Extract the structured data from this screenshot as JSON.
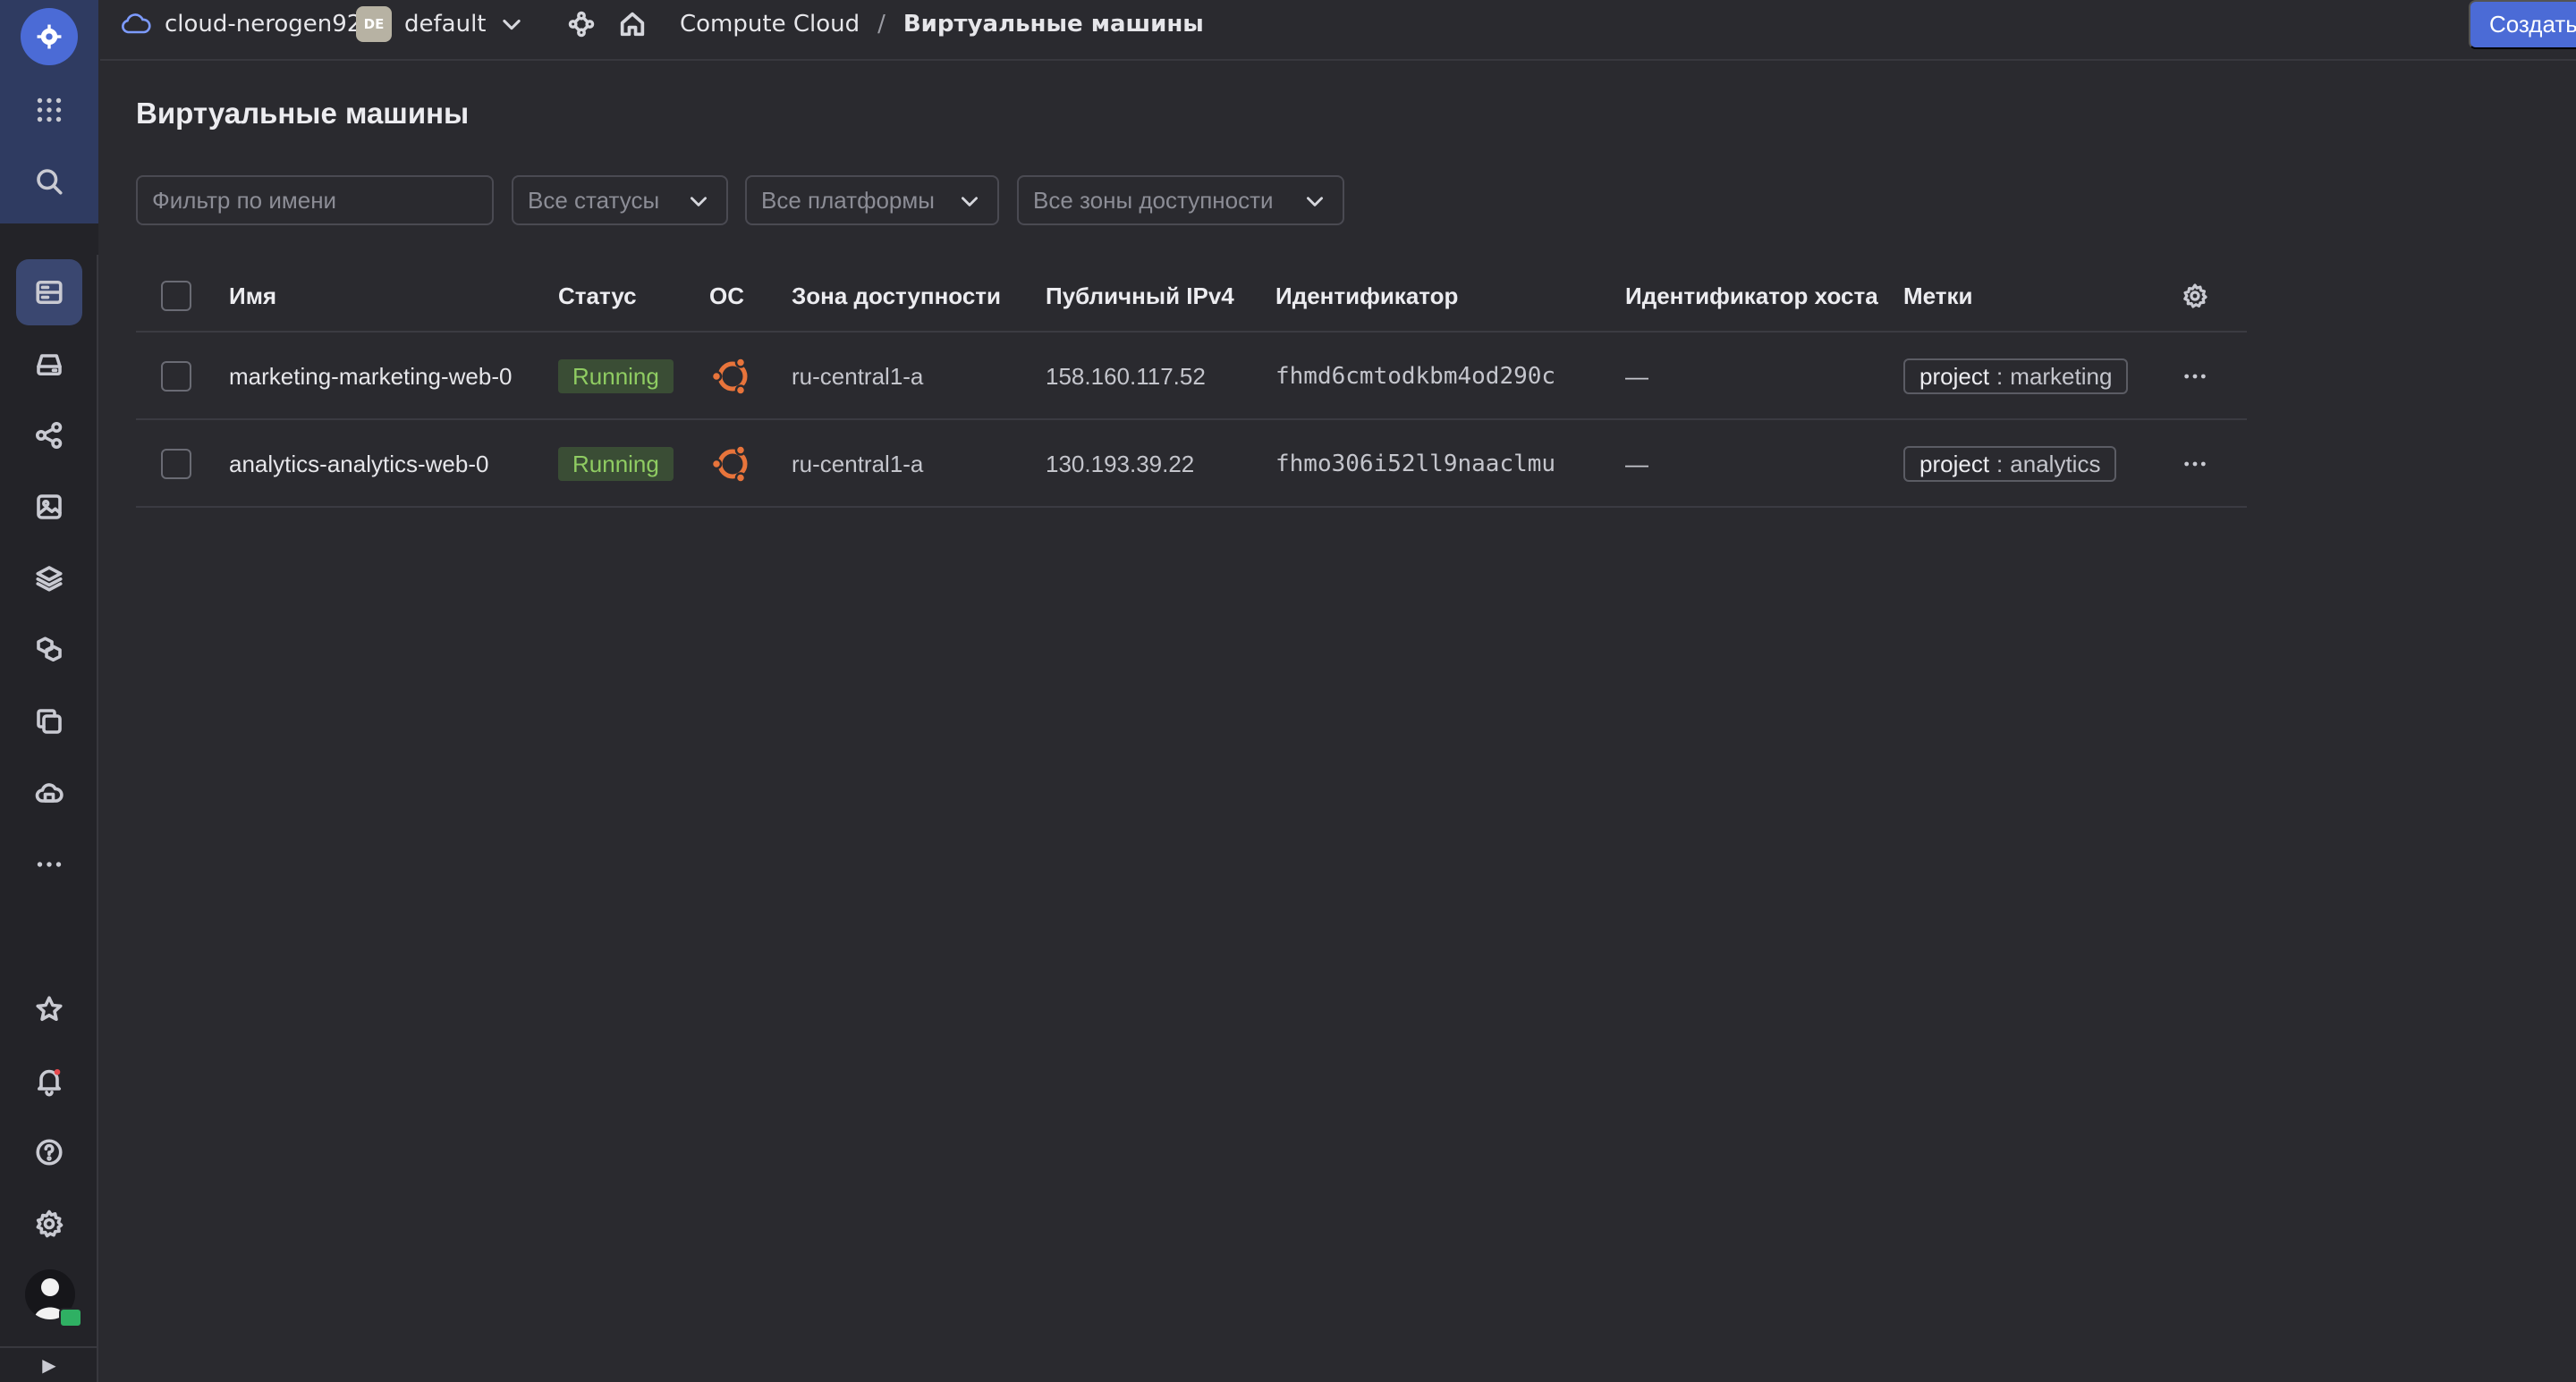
{
  "topbar": {
    "cloud_name": "cloud-nerogen92",
    "folder_badge": "DE",
    "folder_name": "default",
    "breadcrumb_service": "Compute Cloud",
    "breadcrumb_separator": "/",
    "breadcrumb_current": "Виртуальные машины",
    "create_button": "Создать ВМ"
  },
  "page": {
    "title": "Виртуальные машины"
  },
  "filters": {
    "name_placeholder": "Фильтр по имени",
    "status": "Все статусы",
    "platform": "Все платформы",
    "zone": "Все зоны доступности"
  },
  "table": {
    "columns": {
      "name": "Имя",
      "status": "Статус",
      "os": "ОС",
      "zone": "Зона доступности",
      "ip": "Публичный IPv4",
      "id": "Идентификатор",
      "host_id": "Идентификатор хоста",
      "labels": "Метки"
    },
    "rows": [
      {
        "name": "marketing-marketing-web-0",
        "status": "Running",
        "os": "ubuntu-icon",
        "zone": "ru-central1-a",
        "ip": "158.160.117.52",
        "id": "fhmd6cmtodkbm4od290c",
        "host_id": "—",
        "label_key": "project",
        "label_sep": ":",
        "label_value": "marketing"
      },
      {
        "name": "analytics-analytics-web-0",
        "status": "Running",
        "os": "ubuntu-icon",
        "zone": "ru-central1-a",
        "ip": "130.193.39.22",
        "id": "fhmo306i52ll9naaclmu",
        "host_id": "—",
        "label_key": "project",
        "label_sep": ":",
        "label_value": "analytics"
      }
    ]
  },
  "rail": {
    "expand_glyph": "▶"
  },
  "colors": {
    "accent": "#4b6bd6",
    "running_bg": "#3a4d35",
    "running_text": "#8fcc62",
    "ubuntu": "#e8743b",
    "background": "#2a2a2f"
  }
}
